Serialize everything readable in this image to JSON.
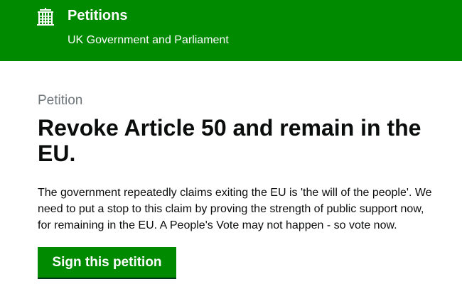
{
  "header": {
    "logo_icon": "portcullis-icon",
    "title": "Petitions",
    "subtitle": "UK Government and Parliament",
    "background_color": "#008a00"
  },
  "petition": {
    "caption": "Petition",
    "title": "Revoke Article 50 and remain in the EU.",
    "description": "The government repeatedly claims exiting the EU is 'the will of the people'. We need to put a stop to this claim by proving the strength of public support now, for remaining in the EU. A People's Vote may not happen - so vote now.",
    "sign_button_label": "Sign this petition",
    "button_color": "#008a00"
  }
}
